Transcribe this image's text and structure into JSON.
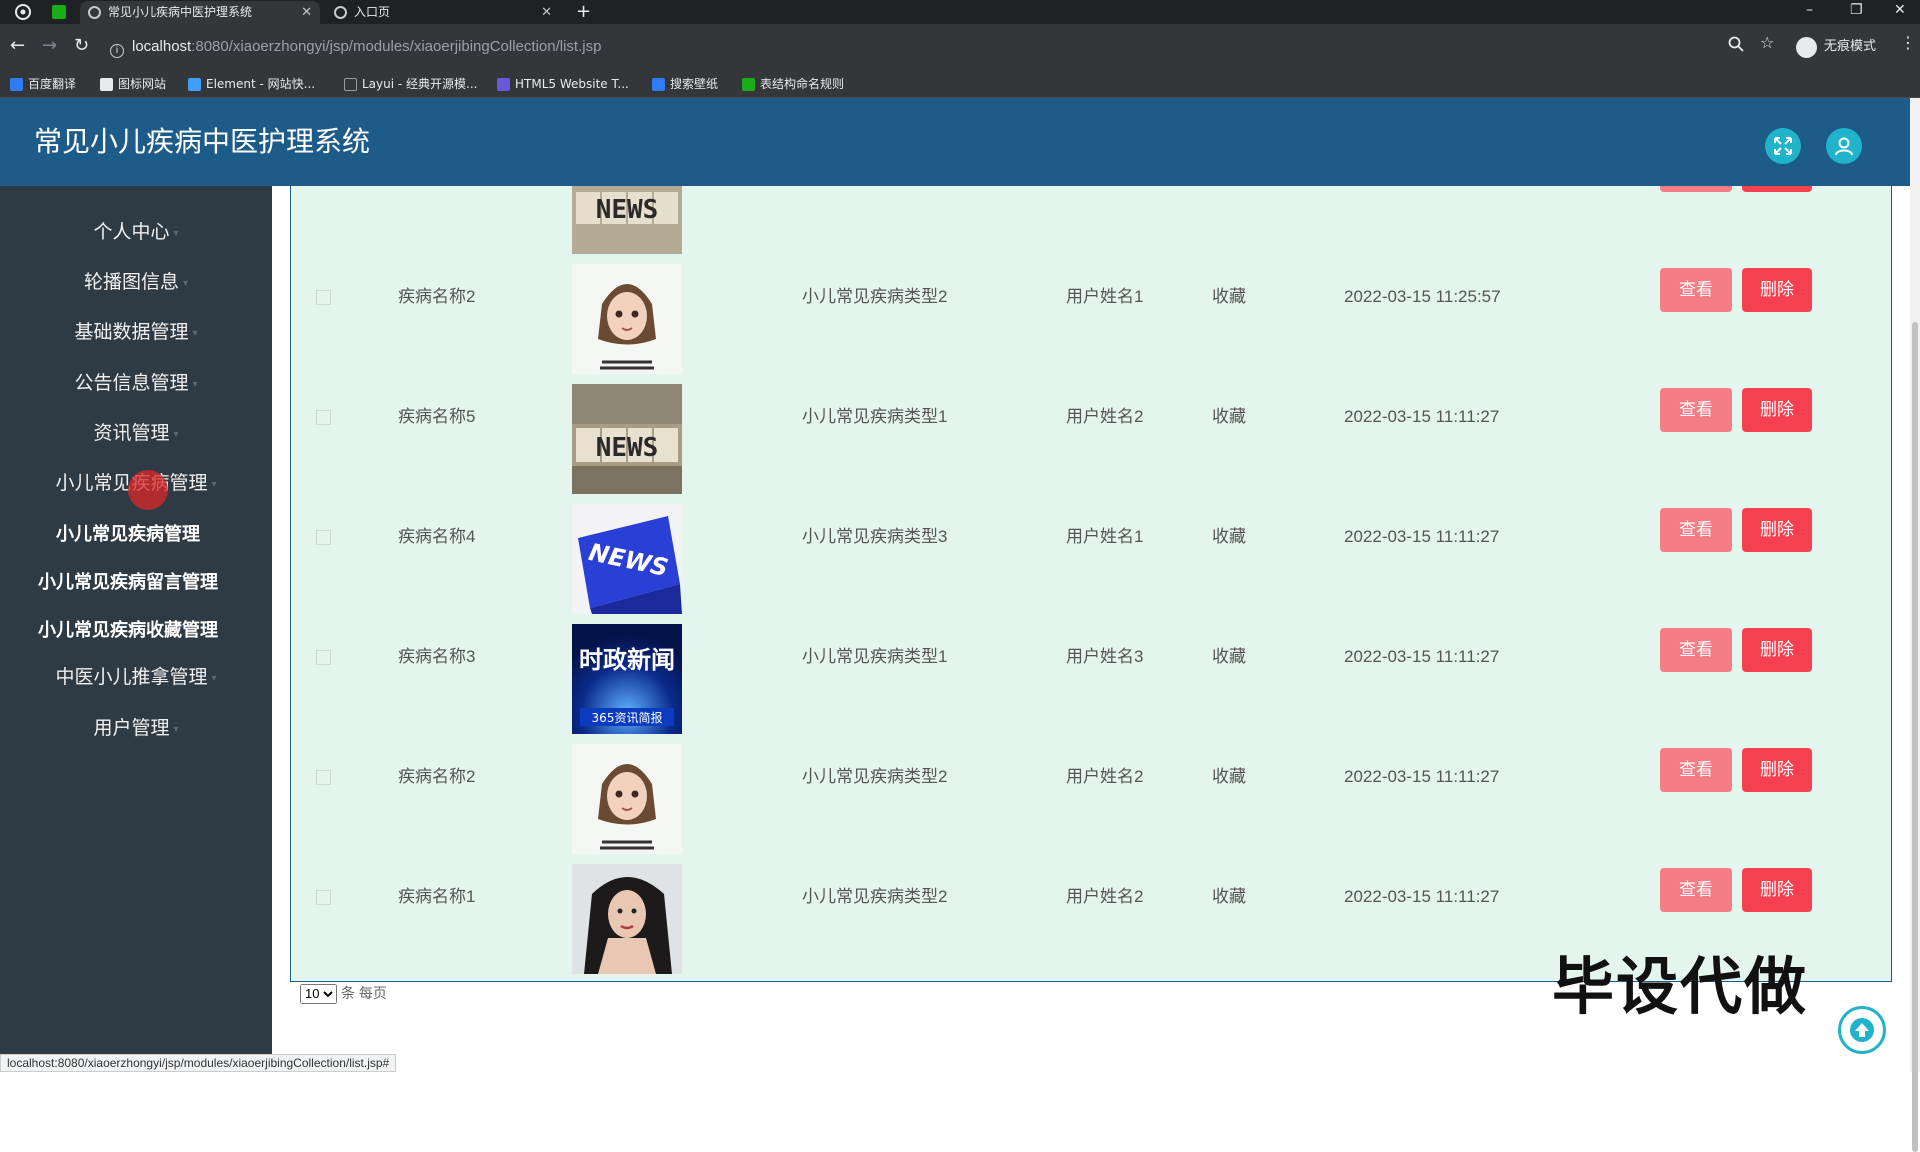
{
  "browser": {
    "tabs": [
      {
        "title": "常见小儿疾病中医护理系统",
        "active": true
      },
      {
        "title": "入口页",
        "active": false
      }
    ],
    "url_host": "localhost",
    "url_path": ":8080/xiaoerzhongyi/jsp/modules/xiaoerjibingCollection/list.jsp",
    "incognito_label": "无痕模式",
    "bookmarks": [
      "百度翻译",
      "图标网站",
      "Element - 网站快...",
      "Layui - 经典开源模...",
      "HTML5 Website T...",
      "搜索壁纸",
      "表结构命名规则"
    ]
  },
  "app": {
    "title": "常见小儿疾病中医护理系统",
    "accent": "#1d5b88"
  },
  "sidebar": {
    "items": [
      "个人中心",
      "轮播图信息",
      "基础数据管理",
      "公告信息管理",
      "资讯管理",
      "小儿常见疾病管理",
      "中医小儿推拿管理",
      "用户管理"
    ],
    "submenu": [
      "小儿常见疾病管理",
      "小儿常见疾病留言管理",
      "小儿常见疾病收藏管理"
    ]
  },
  "table": {
    "rows": [
      {
        "name": "疾病名称2",
        "type": "小儿常见疾病类型2",
        "user": "用户姓名1",
        "action": "收藏",
        "time": "2022-03-15 11:25:57",
        "image": "girl"
      },
      {
        "name": "疾病名称5",
        "type": "小儿常见疾病类型1",
        "user": "用户姓名2",
        "action": "收藏",
        "time": "2022-03-15 11:11:27",
        "image": "news-blocks"
      },
      {
        "name": "疾病名称4",
        "type": "小儿常见疾病类型3",
        "user": "用户姓名1",
        "action": "收藏",
        "time": "2022-03-15 11:11:27",
        "image": "news-key"
      },
      {
        "name": "疾病名称3",
        "type": "小儿常见疾病类型1",
        "user": "用户姓名3",
        "action": "收藏",
        "time": "2022-03-15 11:11:27",
        "image": "politics-news"
      },
      {
        "name": "疾病名称2",
        "type": "小儿常见疾病类型2",
        "user": "用户姓名2",
        "action": "收藏",
        "time": "2022-03-15 11:11:27",
        "image": "girl"
      },
      {
        "name": "疾病名称1",
        "type": "小儿常见疾病类型2",
        "user": "用户姓名2",
        "action": "收藏",
        "time": "2022-03-15 11:11:27",
        "image": "woman-portrait"
      }
    ],
    "view_label": "查看",
    "delete_label": "删除",
    "news_text": "NEWS",
    "politics_text": "时政新闻",
    "politics_sub": "365资讯简报"
  },
  "pager": {
    "page_size": "10",
    "suffix": "条 每页"
  },
  "watermark": "毕设代做",
  "status_url": "localhost:8080/xiaoerzhongyi/jsp/modules/xiaoerjibingCollection/list.jsp#"
}
